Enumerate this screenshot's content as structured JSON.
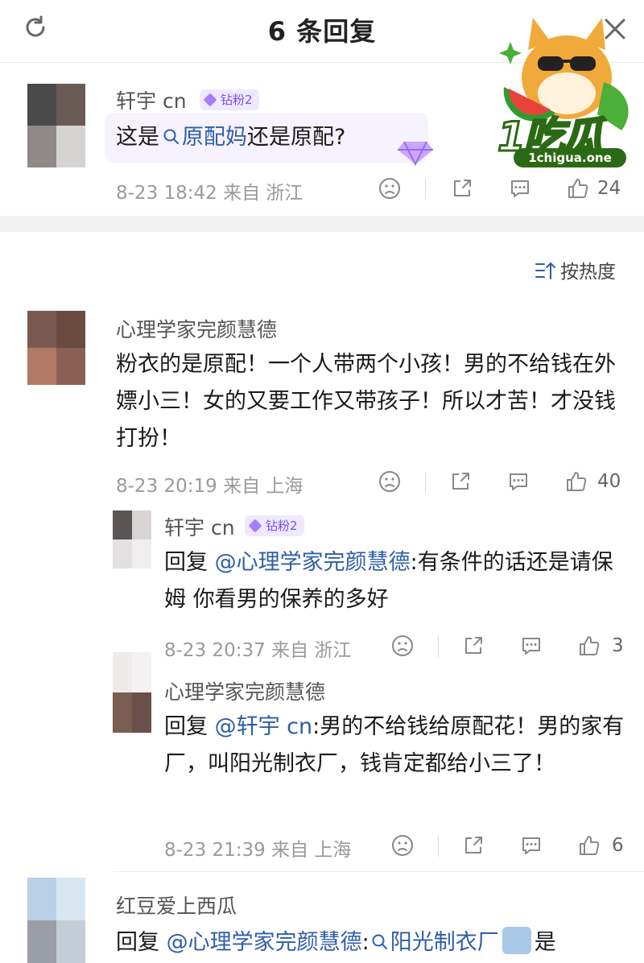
{
  "header": {
    "title": "6 条回复"
  },
  "watermark": {
    "logo": "1吃瓜",
    "url": "1chigua.one"
  },
  "top_comment": {
    "name": "轩宇 cn",
    "badge": "钻粉2",
    "text_pre": "这是",
    "search_link": "原配妈",
    "text_post": "还是原配?",
    "meta": "8-23 18:42 来自 浙江",
    "likes": "24"
  },
  "sort": {
    "label": "按热度"
  },
  "comments": [
    {
      "name": "心理学家完颜慧德",
      "text": "粉衣的是原配！一个人带两个小孩！男的不给钱在外嫖小三！女的又要工作又带孩子！所以才苦！才没钱打扮！",
      "meta": "8-23 20:19 来自 上海",
      "likes": "40"
    }
  ],
  "replies": [
    {
      "name": "轩宇 cn",
      "badge": "钻粉2",
      "prefix": "回复 ",
      "mention": "@心理学家完颜慧德",
      "text": ":有条件的话还是请保姆 你看男的保养的多好",
      "meta": "8-23 20:37 来自 浙江",
      "likes": "3"
    },
    {
      "name": "心理学家完颜慧德",
      "prefix": "回复 ",
      "mention": "@轩宇 cn",
      "text": ":男的不给钱给原配花！男的家有厂，叫阳光制衣厂，钱肯定都给小三了！",
      "meta": "8-23 21:39 来自 上海",
      "likes": "6"
    }
  ],
  "bottom_comment": {
    "name": "红豆爱上西瓜",
    "prefix": "回复 ",
    "mention": "@心理学家完颜慧德",
    "colon": ":",
    "search_link": "阳光制衣厂",
    "suffix": "是"
  },
  "colors": {
    "link": "#2d5ea8",
    "meta": "#9a9a9a",
    "badge_bg": "#efe9ff",
    "badge_text": "#7a4ef5",
    "watermark_green": "#2b6a14"
  },
  "icons": [
    "refresh-icon",
    "close-icon",
    "sort-icon",
    "dislike-icon",
    "share-icon",
    "comment-icon",
    "like-icon",
    "search-icon",
    "gem-icon"
  ]
}
